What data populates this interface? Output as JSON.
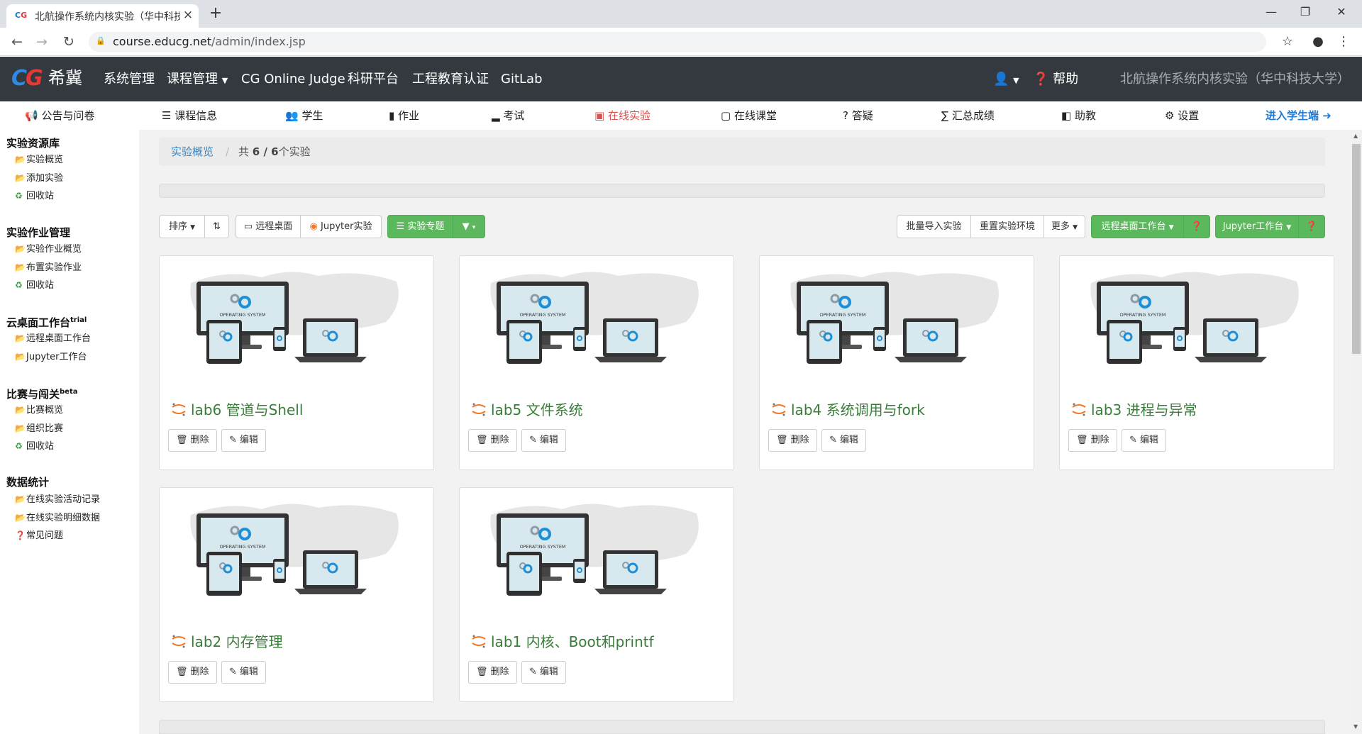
{
  "browser": {
    "tab_title": "北航操作系统内核实验（华中科技",
    "url_host": "course.educg.net",
    "url_path": "/admin/index.jsp"
  },
  "topnav": {
    "logo_text": "希冀",
    "items": [
      "系统管理",
      "课程管理",
      "CG Online Judge",
      "科研平台",
      "工程教育认证",
      "GitLab"
    ],
    "help": "帮助",
    "course": "北航操作系统内核实验（华中科技大学）"
  },
  "subnav": {
    "items": [
      "公告与问卷",
      "课程信息",
      "学生",
      "作业",
      "考试",
      "在线实验",
      "在线课堂",
      "答疑",
      "汇总成绩",
      "助教",
      "设置"
    ],
    "student": "进入学生端"
  },
  "sidebar": {
    "sections": [
      {
        "title": "实验资源库",
        "sup": "",
        "items": [
          "实验概览",
          "添加实验",
          "回收站"
        ]
      },
      {
        "title": "实验作业管理",
        "sup": "",
        "items": [
          "实验作业概览",
          "布置实验作业",
          "回收站"
        ]
      },
      {
        "title": "云桌面工作台",
        "sup": "trial",
        "items": [
          "远程桌面工作台",
          "Jupyter工作台"
        ]
      },
      {
        "title": "比赛与闯关",
        "sup": "beta",
        "items": [
          "比赛概览",
          "组织比赛",
          "回收站"
        ]
      },
      {
        "title": "数据统计",
        "sup": "",
        "items": [
          "在线实验活动记录",
          "在线实验明细数据"
        ]
      }
    ],
    "faq": "常见问题"
  },
  "breadcrumb": {
    "link": "实验概览",
    "count_prefix": "共",
    "count": "6 / 6",
    "count_suffix": "个实验"
  },
  "toolbar": {
    "sort": "排序",
    "remote_desktop": "远程桌面",
    "jupyter_lab": "Jupyter实验",
    "topic": "实验专题",
    "batch_import": "批量导入实验",
    "reset_env": "重置实验环境",
    "more": "更多",
    "remote_workbench": "远程桌面工作台",
    "jupyter_workbench": "Jupyter工作台"
  },
  "card_image": {
    "os_label": "OPERATING SYSTEM"
  },
  "labs": [
    {
      "title": "lab6 管道与Shell"
    },
    {
      "title": "lab5 文件系统"
    },
    {
      "title": "lab4 系统调用与fork"
    },
    {
      "title": "lab3 进程与异常"
    },
    {
      "title": "lab2 内存管理"
    },
    {
      "title": "lab1 内核、Boot和printf"
    }
  ],
  "card_actions": {
    "delete": "删除",
    "edit": "编辑"
  },
  "colors": {
    "nav_bg": "#34393f",
    "active_red": "#d9534f",
    "green": "#5cb85c",
    "link_blue": "#1e7bd6",
    "title_green": "#3a7d3a"
  }
}
